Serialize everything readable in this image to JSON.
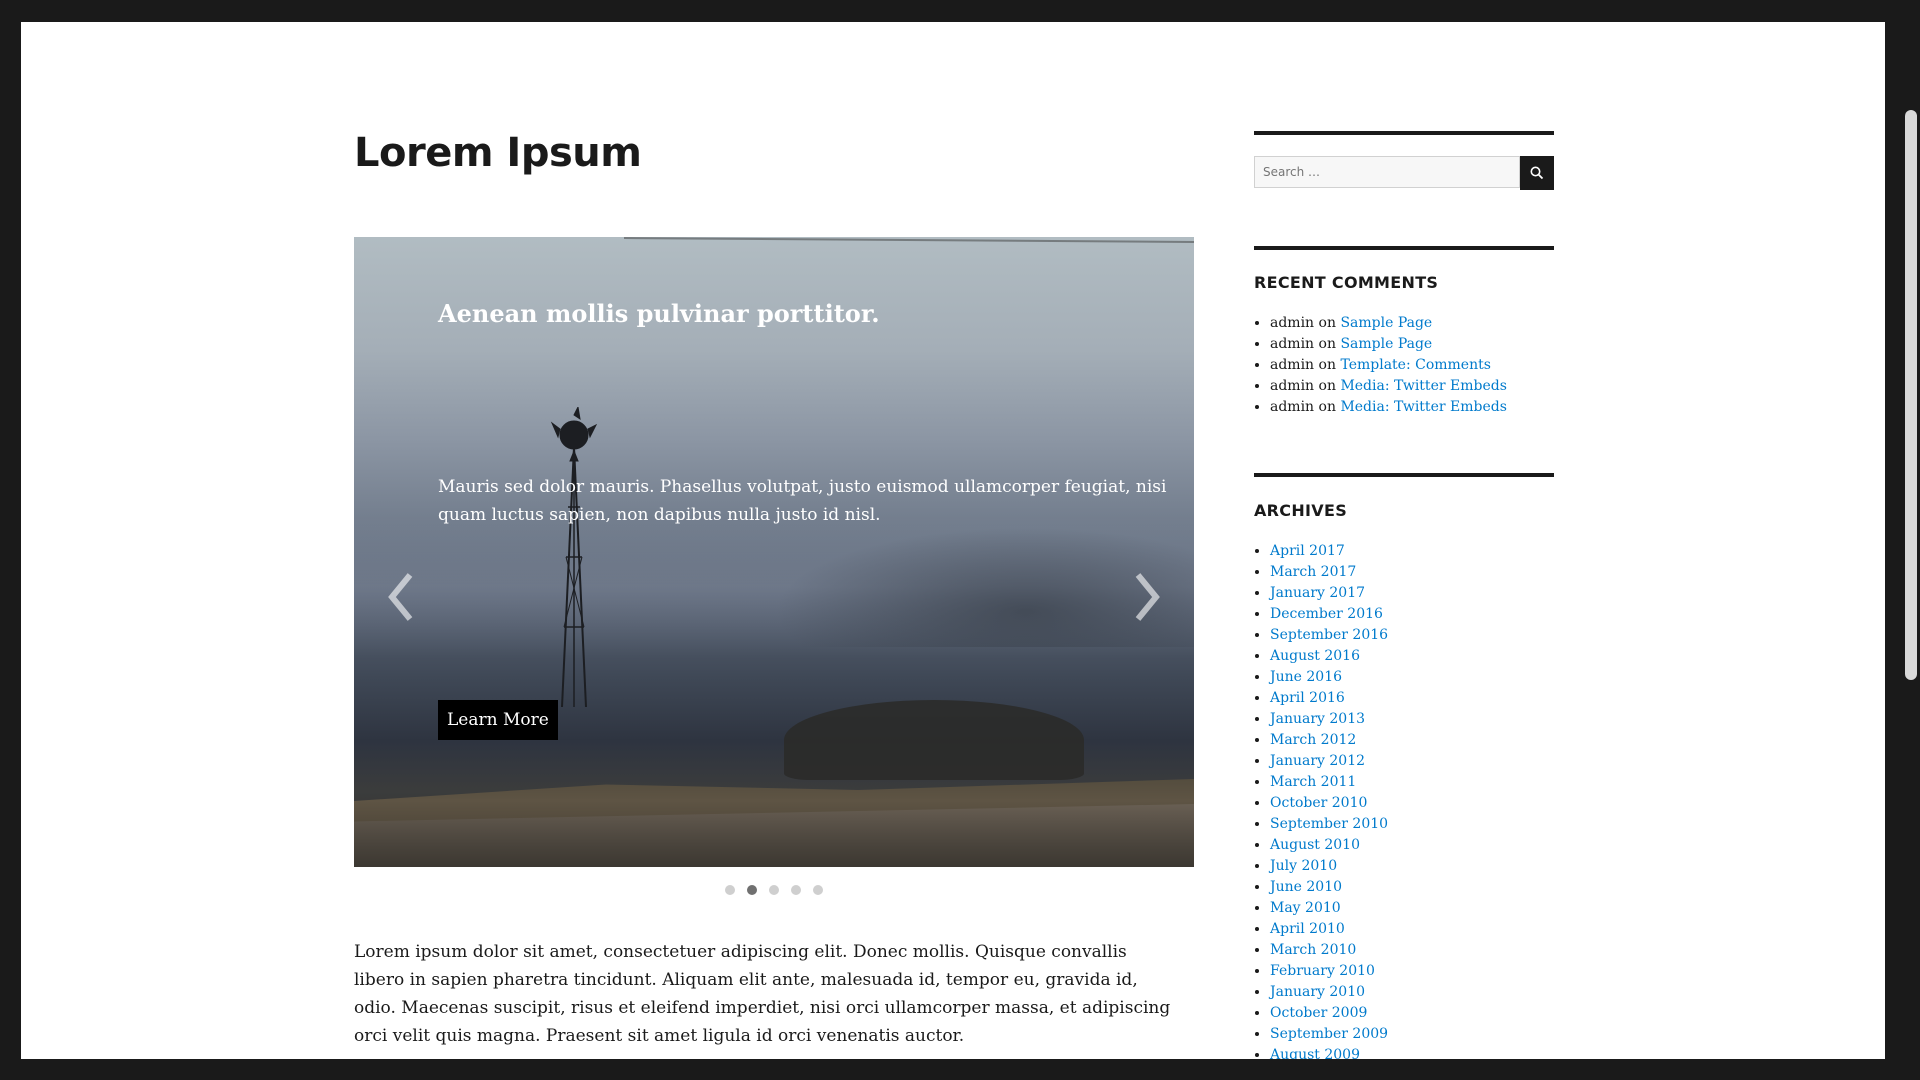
{
  "page": {
    "title": "Lorem Ipsum",
    "body": "Lorem ipsum dolor sit amet, consectetuer adipiscing elit. Donec mollis. Quisque convallis libero in sapien pharetra tincidunt. Aliquam elit ante, malesuada id, tempor eu, gravida id, odio. Maecenas suscipit, risus et eleifend imperdiet, nisi orci ullamcorper massa, et adipiscing orci velit quis magna. Praesent sit amet ligula id orci venenatis auctor."
  },
  "slider": {
    "heading": "Aenean mollis pulvinar porttitor.",
    "text": "Mauris sed dolor mauris. Phasellus volutpat, justo euismod ullamcorper feugiat, nisi quam luctus sapien, non dapibus nulla justo id nisl.",
    "button_label": "Learn More",
    "prev_icon": "chevron-left-icon",
    "next_icon": "chevron-right-icon",
    "slide_count": 5,
    "active_slide": 2
  },
  "sidebar": {
    "search_placeholder": "Search …",
    "search_icon": "search-icon",
    "recent_comments_title": "RECENT COMMENTS",
    "recent_comments": [
      {
        "author": "admin",
        "sep": "on",
        "post": "Sample Page"
      },
      {
        "author": "admin",
        "sep": "on",
        "post": "Sample Page"
      },
      {
        "author": "admin",
        "sep": "on",
        "post": "Template: Comments"
      },
      {
        "author": "admin",
        "sep": "on",
        "post": "Media: Twitter Embeds"
      },
      {
        "author": "admin",
        "sep": "on",
        "post": "Media: Twitter Embeds"
      }
    ],
    "archives_title": "ARCHIVES",
    "archives": [
      "April 2017",
      "March 2017",
      "January 2017",
      "December 2016",
      "September 2016",
      "August 2016",
      "June 2016",
      "April 2016",
      "January 2013",
      "March 2012",
      "January 2012",
      "March 2011",
      "October 2010",
      "September 2010",
      "August 2010",
      "July 2010",
      "June 2010",
      "May 2010",
      "April 2010",
      "March 2010",
      "February 2010",
      "January 2010",
      "October 2009",
      "September 2009",
      "August 2009"
    ]
  },
  "colors": {
    "link": "#007acc",
    "text": "#1a1a1a",
    "frame": "#1a1a1a"
  }
}
